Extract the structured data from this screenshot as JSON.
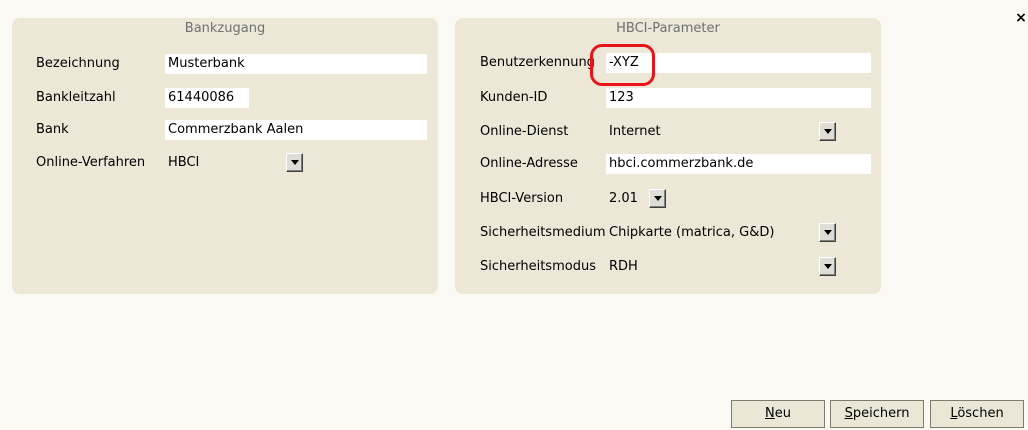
{
  "close_label": "×",
  "bankzugang": {
    "title": "Bankzugang",
    "bezeichnung_label": "Bezeichnung",
    "bezeichnung_value": "Musterbank",
    "blz_label": "Bankleitzahl",
    "blz_value": "61440086",
    "bank_label": "Bank",
    "bank_value": "Commerzbank Aalen",
    "verfahren_label": "Online-Verfahren",
    "verfahren_value": "HBCI"
  },
  "hbci": {
    "title": "HBCI-Parameter",
    "benutzer_label": "Benutzerkennung",
    "benutzer_value": "-XYZ",
    "kunden_label": "Kunden-ID",
    "kunden_value": "123",
    "dienst_label": "Online-Dienst",
    "dienst_value": "Internet",
    "adresse_label": "Online-Adresse",
    "adresse_value": "hbci.commerzbank.de",
    "version_label": "HBCI-Version",
    "version_value": "2.01",
    "medium_label": "Sicherheitsmedium",
    "medium_value": "Chipkarte (matrica, G&D)",
    "modus_label": "Sicherheitsmodus",
    "modus_value": "RDH"
  },
  "buttons": {
    "neu_first": "N",
    "neu_rest": "eu",
    "speichern_first": "S",
    "speichern_rest": "peichern",
    "loeschen_first": "L",
    "loeschen_rest": "öschen"
  },
  "colors": {
    "panel": "#ece7d7",
    "highlight": "#e8131b"
  }
}
